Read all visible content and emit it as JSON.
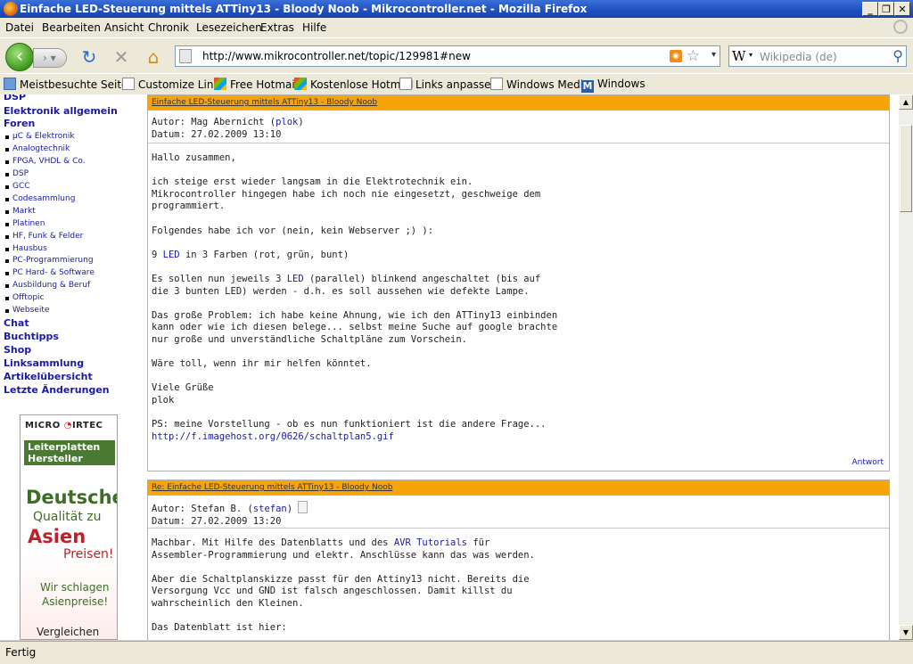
{
  "window": {
    "title": "Einfache LED-Steuerung mittels ATTiny13 - Bloody Noob - Mikrocontroller.net - Mozilla Firefox"
  },
  "menu": [
    "Datei",
    "Bearbeiten",
    "Ansicht",
    "Chronik",
    "Lesezeichen",
    "Extras",
    "Hilfe"
  ],
  "nav": {
    "url": "http://www.mikrocontroller.net/topic/129981#new",
    "search_placeholder": "Wikipedia (de)",
    "search_engine_label": "W"
  },
  "bookmarks": [
    "Meistbesuchte Seiten",
    "Customize Links",
    "Free Hotmail",
    "Kostenlose Hotmail",
    "Links anpassen",
    "Windows Media",
    "Windows"
  ],
  "sidebar": {
    "top": [
      "DSP",
      "Elektronik allgemein",
      "Foren"
    ],
    "forums": [
      "µC & Elektronik",
      "Analogtechnik",
      "FPGA, VHDL & Co.",
      "DSP",
      "GCC",
      "Codesammlung",
      "Markt",
      "Platinen",
      "HF, Funk & Felder",
      "Hausbus",
      "PC-Programmierung",
      "PC Hard- & Software",
      "Ausbildung & Beruf",
      "Offtopic",
      "Webseite"
    ],
    "bottom": [
      "Chat",
      "Buchtipps",
      "Shop",
      "Linksammlung",
      "Artikelübersicht",
      "Letzte Änderungen"
    ]
  },
  "ad": {
    "logo_left": "MICRO",
    "logo_right": "IRTEC",
    "band": "Leiterplatten Hersteller",
    "line1": "Deutsche",
    "line2": "Qualität zu",
    "line3": "Asien",
    "line4": "Preisen!",
    "line5": "Wir schlagen",
    "line6": "Asienpreise!",
    "line7": "Vergleichen"
  },
  "posts": [
    {
      "title": "Einfache LED-Steuerung mittels ATTiny13 - Bloody Noob",
      "author_prefix": "Autor: Mag Abernicht (",
      "author_link": "plok",
      "author_suffix": ")",
      "date": "Datum: 27.02.2009 13:10",
      "body": {
        "p1": "Hallo zusammen,",
        "p2a": "ich steige erst wieder langsam in die Elektrotechnik ein.",
        "p2b": "Mikrocontroller hingegen habe ich noch nie eingesetzt, geschweige dem",
        "p2c": "programmiert.",
        "p3": "Folgendes habe ich vor (nein, kein Webserver ;) ):",
        "p4a": "9 ",
        "p4led": "LED",
        "p4b": " in 3 Farben (rot, grün, bunt)",
        "p5a": "Es sollen nun jeweils 3 ",
        "p5led": "LED",
        "p5b": " (parallel) blinkend angeschaltet (bis auf",
        "p5c": "die 3 bunten LED) werden - d.h. es soll aussehen wie defekte Lampe.",
        "p6a": "Das große Problem: ich habe keine Ahnung, wie ich den ATTiny13 einbinden",
        "p6b": "kann oder wie ich diesen belege... selbst meine Suche auf google brachte",
        "p6c": "nur große und unverständliche Schaltpläne zum Vorschein.",
        "p7": "Wäre toll, wenn ihr mir helfen könntet.",
        "p8a": "Viele Grüße",
        "p8b": "plok",
        "p9": "PS: meine Vorstellung - ob es nun funktioniert ist die andere Frage...",
        "p9link": "http://f.imagehost.org/0626/schaltplan5.gif"
      },
      "reply": "Antwort"
    },
    {
      "title": "Re: Einfache LED-Steuerung mittels ATTiny13 - Bloody Noob",
      "author_prefix": "Autor: Stefan B. (",
      "author_link": "stefan",
      "author_suffix": ")",
      "date": "Datum: 27.02.2009 13:20",
      "body": {
        "p1a": "Machbar. Mit Hilfe des Datenblatts und des ",
        "p1link": "AVR Tutorials",
        "p1b": " für",
        "p1c": "Assembler-Programmierung und elektr. Anschlüsse kann das was werden.",
        "p2a": "Aber die Schaltplanskizze passt für den Attiny13 nicht. Bereits die",
        "p2b": "Versorgung Vcc und GND ist falsch angeschlossen. Damit killst du",
        "p2c": "wahrscheinlich den Kleinen.",
        "p3": "Das Datenblatt ist hier:"
      }
    }
  ],
  "status": "Fertig"
}
